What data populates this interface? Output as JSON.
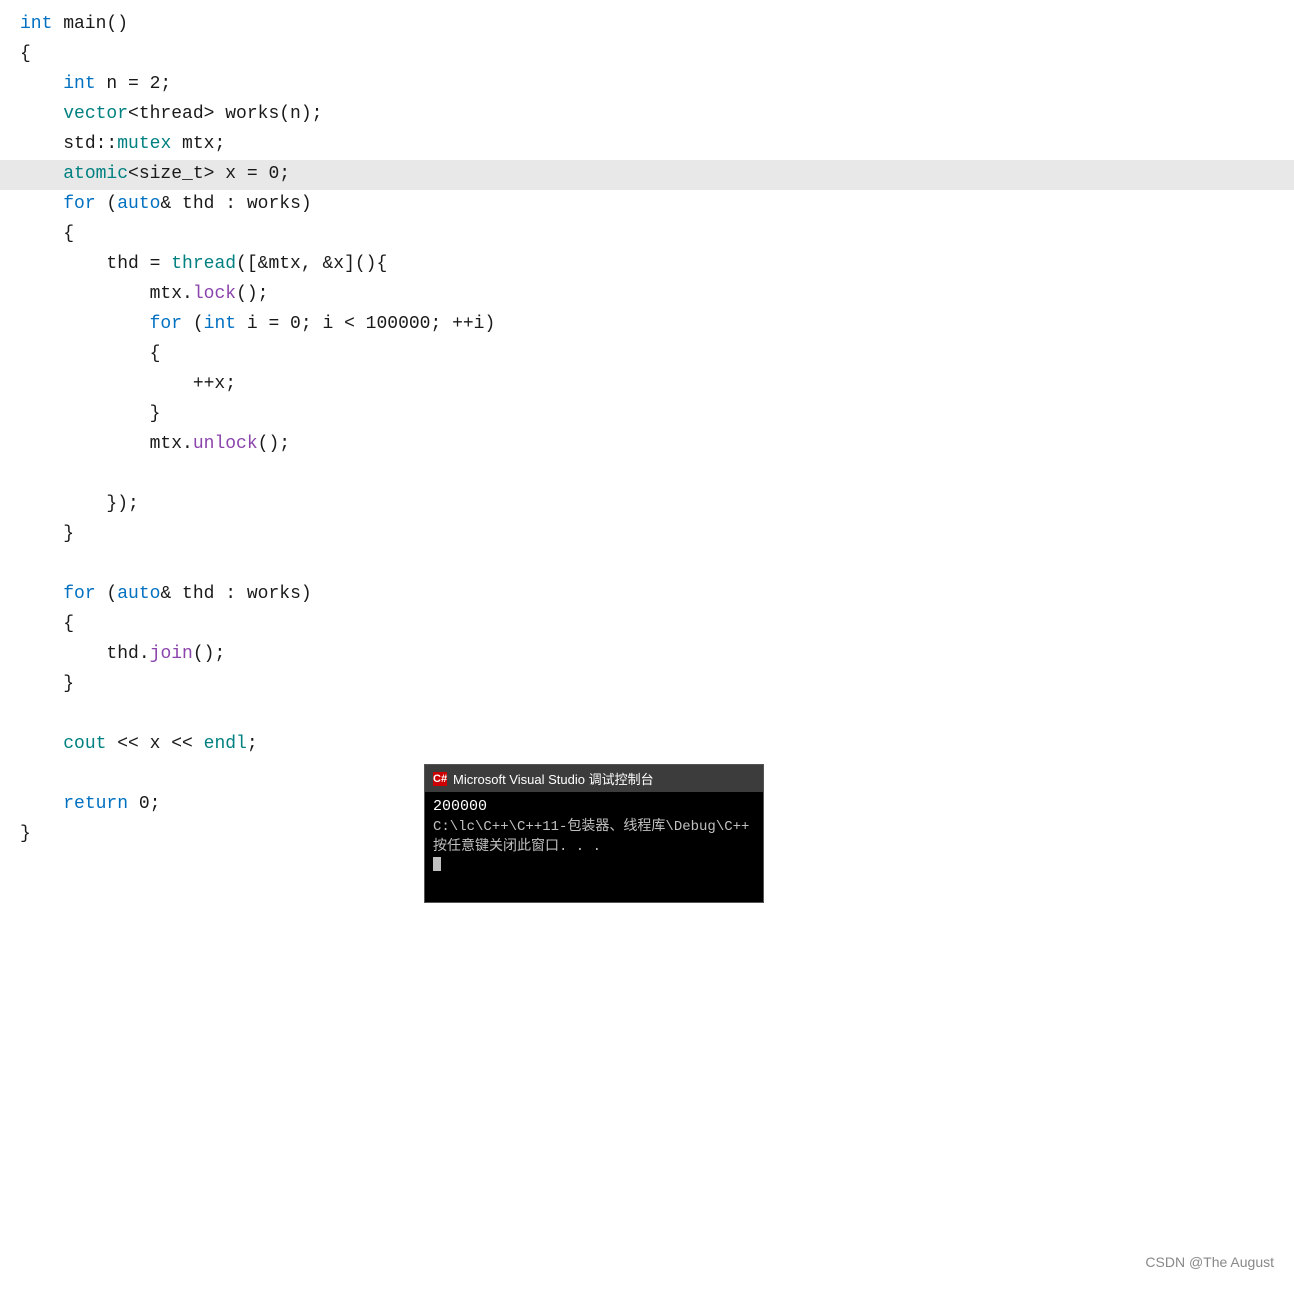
{
  "code": {
    "lines": [
      {
        "id": "L1",
        "indent": 0,
        "highlight": false,
        "tokens": [
          {
            "t": "int",
            "c": "kw-blue"
          },
          {
            "t": " main()",
            "c": "text-black"
          }
        ]
      },
      {
        "id": "L2",
        "indent": 0,
        "highlight": false,
        "tokens": [
          {
            "t": "{",
            "c": "text-black"
          }
        ]
      },
      {
        "id": "L3",
        "indent": 1,
        "highlight": false,
        "tokens": [
          {
            "t": "int",
            "c": "kw-blue"
          },
          {
            "t": " n = 2;",
            "c": "text-black"
          }
        ]
      },
      {
        "id": "L4",
        "indent": 1,
        "highlight": false,
        "tokens": [
          {
            "t": "vector",
            "c": "kw-teal"
          },
          {
            "t": "<thread> works(n);",
            "c": "text-black"
          }
        ]
      },
      {
        "id": "L5",
        "indent": 1,
        "highlight": false,
        "tokens": [
          {
            "t": "std::",
            "c": "text-black"
          },
          {
            "t": "mutex",
            "c": "kw-teal"
          },
          {
            "t": " mtx;",
            "c": "text-black"
          }
        ]
      },
      {
        "id": "L6",
        "indent": 1,
        "highlight": true,
        "tokens": [
          {
            "t": "atomic",
            "c": "kw-teal"
          },
          {
            "t": "<size_t> x = 0;",
            "c": "text-black"
          }
        ]
      },
      {
        "id": "L7",
        "indent": 1,
        "highlight": false,
        "tokens": [
          {
            "t": "for",
            "c": "kw-blue"
          },
          {
            "t": " (",
            "c": "text-black"
          },
          {
            "t": "auto",
            "c": "kw-blue"
          },
          {
            "t": "& thd : works)",
            "c": "text-black"
          }
        ]
      },
      {
        "id": "L8",
        "indent": 1,
        "highlight": false,
        "tokens": [
          {
            "t": "{",
            "c": "text-black"
          }
        ]
      },
      {
        "id": "L9",
        "indent": 2,
        "highlight": false,
        "tokens": [
          {
            "t": "thd = ",
            "c": "text-black"
          },
          {
            "t": "thread",
            "c": "kw-teal"
          },
          {
            "t": "([&mtx, &x](){",
            "c": "text-black"
          }
        ]
      },
      {
        "id": "L10",
        "indent": 3,
        "highlight": false,
        "tokens": [
          {
            "t": "mtx.",
            "c": "text-black"
          },
          {
            "t": "lock",
            "c": "kw-purple"
          },
          {
            "t": "();",
            "c": "text-black"
          }
        ]
      },
      {
        "id": "L11",
        "indent": 3,
        "highlight": false,
        "tokens": [
          {
            "t": "for",
            "c": "kw-blue"
          },
          {
            "t": " (",
            "c": "text-black"
          },
          {
            "t": "int",
            "c": "kw-blue"
          },
          {
            "t": " i = 0; i < 100000; ++i)",
            "c": "text-black"
          }
        ]
      },
      {
        "id": "L12",
        "indent": 3,
        "highlight": false,
        "tokens": [
          {
            "t": "{",
            "c": "text-black"
          }
        ]
      },
      {
        "id": "L13",
        "indent": 4,
        "highlight": false,
        "tokens": [
          {
            "t": "++x;",
            "c": "text-black"
          }
        ]
      },
      {
        "id": "L14",
        "indent": 3,
        "highlight": false,
        "tokens": [
          {
            "t": "}",
            "c": "text-black"
          }
        ]
      },
      {
        "id": "L15",
        "indent": 3,
        "highlight": false,
        "tokens": [
          {
            "t": "mtx.",
            "c": "text-black"
          },
          {
            "t": "unlock",
            "c": "kw-purple"
          },
          {
            "t": "();",
            "c": "text-black"
          }
        ]
      },
      {
        "id": "L16",
        "indent": 2,
        "highlight": false,
        "tokens": []
      },
      {
        "id": "L17",
        "indent": 2,
        "highlight": false,
        "tokens": [
          {
            "t": "});",
            "c": "text-black"
          }
        ]
      },
      {
        "id": "L18",
        "indent": 1,
        "highlight": false,
        "tokens": [
          {
            "t": "}",
            "c": "text-black"
          }
        ]
      },
      {
        "id": "L19",
        "indent": 0,
        "highlight": false,
        "tokens": []
      },
      {
        "id": "L20",
        "indent": 1,
        "highlight": false,
        "tokens": [
          {
            "t": "for",
            "c": "kw-blue"
          },
          {
            "t": " (",
            "c": "text-black"
          },
          {
            "t": "auto",
            "c": "kw-blue"
          },
          {
            "t": "& thd : works)",
            "c": "text-black"
          }
        ]
      },
      {
        "id": "L21",
        "indent": 1,
        "highlight": false,
        "tokens": [
          {
            "t": "{",
            "c": "text-black"
          }
        ]
      },
      {
        "id": "L22",
        "indent": 2,
        "highlight": false,
        "tokens": [
          {
            "t": "thd.",
            "c": "text-black"
          },
          {
            "t": "join",
            "c": "kw-purple"
          },
          {
            "t": "();",
            "c": "text-black"
          }
        ]
      },
      {
        "id": "L23",
        "indent": 1,
        "highlight": false,
        "tokens": [
          {
            "t": "}",
            "c": "text-black"
          }
        ]
      },
      {
        "id": "L24",
        "indent": 0,
        "highlight": false,
        "tokens": []
      },
      {
        "id": "L25",
        "indent": 1,
        "highlight": false,
        "tokens": [
          {
            "t": "cout",
            "c": "kw-teal"
          },
          {
            "t": " << x << ",
            "c": "text-black"
          },
          {
            "t": "endl",
            "c": "kw-teal"
          },
          {
            "t": ";",
            "c": "text-black"
          }
        ]
      },
      {
        "id": "L26",
        "indent": 0,
        "highlight": false,
        "tokens": []
      },
      {
        "id": "L27",
        "indent": 1,
        "highlight": false,
        "tokens": [
          {
            "t": "return",
            "c": "kw-blue"
          },
          {
            "t": " 0;",
            "c": "text-black"
          }
        ]
      },
      {
        "id": "L28",
        "indent": 0,
        "highlight": false,
        "tokens": [
          {
            "t": "}",
            "c": "text-black"
          }
        ]
      }
    ]
  },
  "terminal": {
    "title": "Microsoft Visual Studio 调试控制台",
    "icon_label": "VS",
    "output_line": "200000",
    "path_line": "C:\\lc\\C++\\C++11-包装器、线程库\\Debug\\C++",
    "prompt_line": "按任意键关闭此窗口. . ."
  },
  "watermark": {
    "text": "CSDN @The  August"
  }
}
